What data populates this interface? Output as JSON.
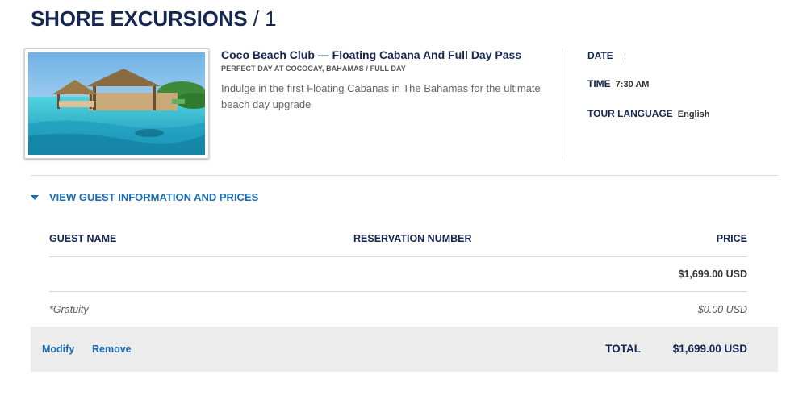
{
  "header": {
    "title": "SHORE EXCURSIONS",
    "separator": " / ",
    "count": "1"
  },
  "tour": {
    "image_icon": "beach-cabana-photo",
    "title": "Coco Beach Club — Floating Cabana And Full Day Pass",
    "subtitle": "PERFECT DAY AT COCOCAY, BAHAMAS / FULL DAY",
    "description": "Indulge in the first Floating Cabanas in The Bahamas for the ultimate beach day upgrade"
  },
  "details": {
    "date_label": "DATE",
    "date_value": "",
    "time_label": "TIME",
    "time_value": "7:30 AM",
    "language_label": "TOUR LANGUAGE",
    "language_value": "English"
  },
  "guest_section": {
    "toggle_label": "VIEW GUEST INFORMATION AND PRICES",
    "toggle_icon": "caret-down-icon",
    "columns": {
      "guest_name": "GUEST NAME",
      "reservation_number": "RESERVATION NUMBER",
      "price": "PRICE"
    },
    "rows": [
      {
        "guest_name": "",
        "reservation_number": "",
        "price": "$1,699.00 USD"
      },
      {
        "guest_name": "*Gratuity",
        "reservation_number": "",
        "price": "$0.00 USD"
      }
    ]
  },
  "footer": {
    "modify_label": "Modify",
    "remove_label": "Remove",
    "total_label": "TOTAL",
    "total_value": "$1,699.00 USD"
  },
  "colors": {
    "navy": "#15264f",
    "link_blue": "#1c6cb3",
    "footer_bg": "#ececec"
  }
}
